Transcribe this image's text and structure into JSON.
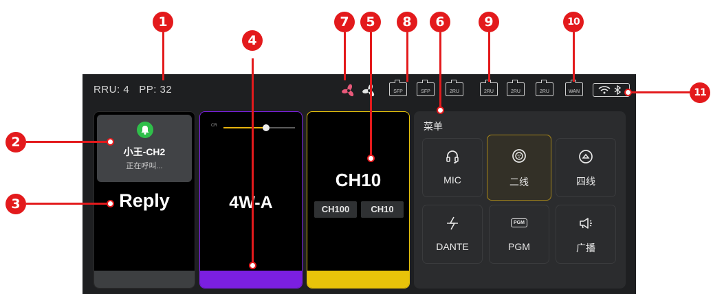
{
  "status_bar": {
    "rru": "RRU: 4",
    "pp": "PP: 32",
    "sfp_label": "SFP",
    "ru_label": "2RU",
    "wan_label": "WAN"
  },
  "cards": {
    "call": {
      "name": "小王-CH2",
      "status": "正在呼叫...",
      "reply": "Reply"
    },
    "fourwire": {
      "name": "4W-A",
      "volume_label": "CR",
      "volume_level": 0.6
    },
    "channel": {
      "main": "CH10",
      "sub1": "CH100",
      "sub2": "CH10"
    }
  },
  "menu": {
    "title": "菜单",
    "items": [
      "MIC",
      "二线",
      "四线",
      "DANTE",
      "PGM",
      "广播"
    ],
    "pgm_badge": "PGM"
  },
  "callouts": [
    "1",
    "2",
    "3",
    "4",
    "5",
    "6",
    "7",
    "8",
    "9",
    "10",
    "11"
  ],
  "colors": {
    "callout": "#e31a1c",
    "fourwire": "#7b1fe0",
    "channel": "#e8c30a",
    "call_bell": "#2fbf4a"
  }
}
